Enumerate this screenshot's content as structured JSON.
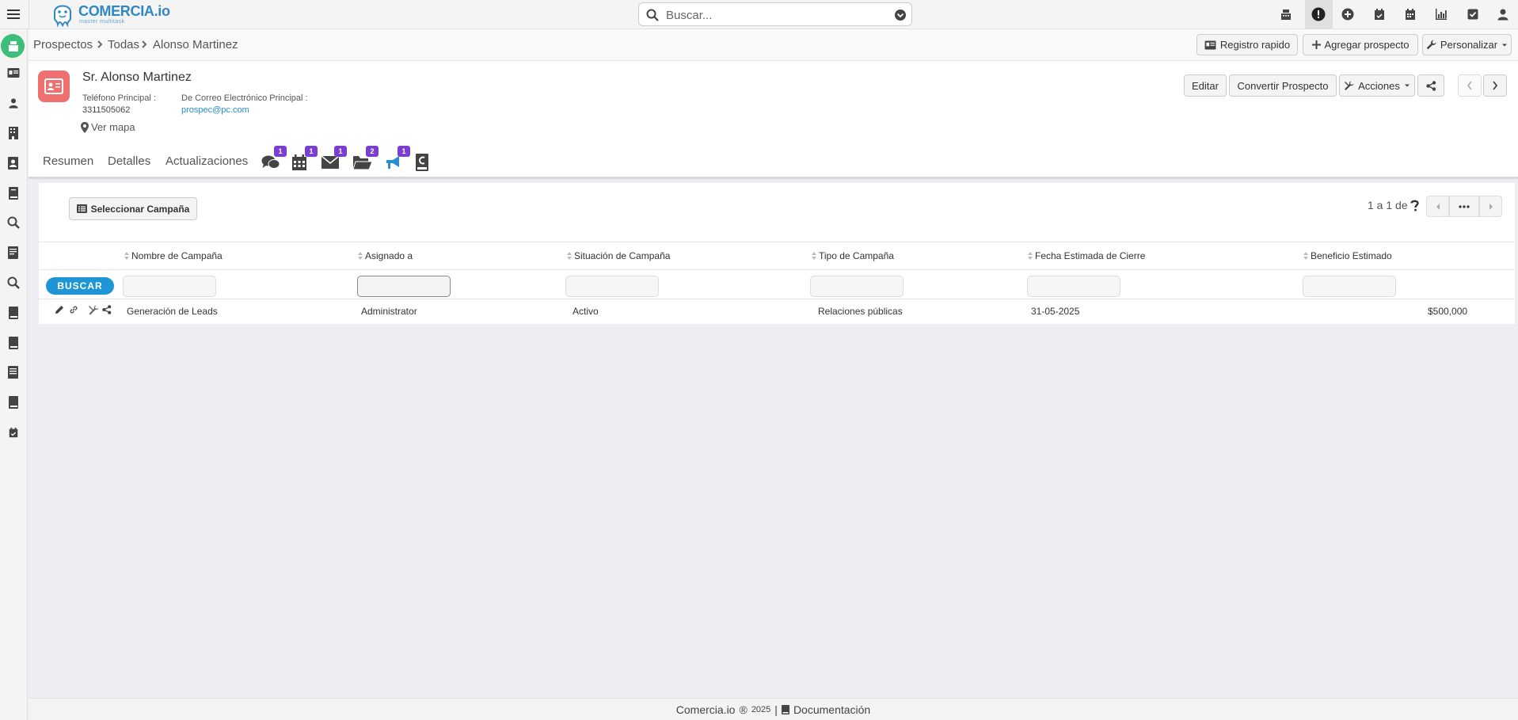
{
  "app": {
    "logo_text": "COMERCIA",
    "logo_suffix": ".io",
    "logo_tagline": "master multitask"
  },
  "search": {
    "placeholder": "Buscar..."
  },
  "topbar_icons": [
    "cash-register-icon",
    "alert-icon",
    "plus-circle-icon",
    "calendar-check-icon",
    "calendar-icon",
    "bar-chart-icon",
    "checkbox-icon",
    "user-icon"
  ],
  "breadcrumb": {
    "module": "Prospectos",
    "list": "Todas",
    "record": "Alonso Martinez"
  },
  "actions": {
    "quick_register": "Registro rapido",
    "add_prospect": "Agregar prospecto",
    "customize": "Personalizar"
  },
  "record": {
    "name": "Sr. Alonso Martinez",
    "phone_label": "Teléfono Principal :",
    "phone_value": "3311505062",
    "email_label": "De Correo Electrónico Principal :",
    "email_value": "prospec@pc.com",
    "map_link": "Ver mapa"
  },
  "record_buttons": {
    "edit": "Editar",
    "convert": "Convertir Prospecto",
    "actions": "Acciones"
  },
  "tabs": {
    "summary": "Resumen",
    "details": "Detalles",
    "updates": "Actualizaciones"
  },
  "tab_badges": {
    "comments": "1",
    "calendar": "1",
    "email": "1",
    "documents": "2",
    "campaigns": "1"
  },
  "campaigns": {
    "select_button": "Seleccionar Campaña",
    "pager_text": "1 a 1  de",
    "search_button": "BUSCAR",
    "columns": [
      "Nombre de Campaña",
      "Asignado a",
      "Situación de Campaña",
      "Tipo de Campaña",
      "Fecha Estimada de Cierre",
      "Beneficio Estimado"
    ],
    "rows": [
      {
        "name": "Generación de Leads",
        "assigned": "Administrator",
        "status": "Activo",
        "type": "Relaciones públicas",
        "close_date": "31-05-2025",
        "benefit": "$500,000"
      }
    ]
  },
  "footer": {
    "brand": "Comercia.io",
    "year": "2025",
    "separator": "|",
    "docs": "Documentación"
  },
  "colors": {
    "accent": "#2a8bd0",
    "badge": "#7a3fd0",
    "active_rail": "#3dbf7a",
    "record_icon": "#f07070"
  }
}
